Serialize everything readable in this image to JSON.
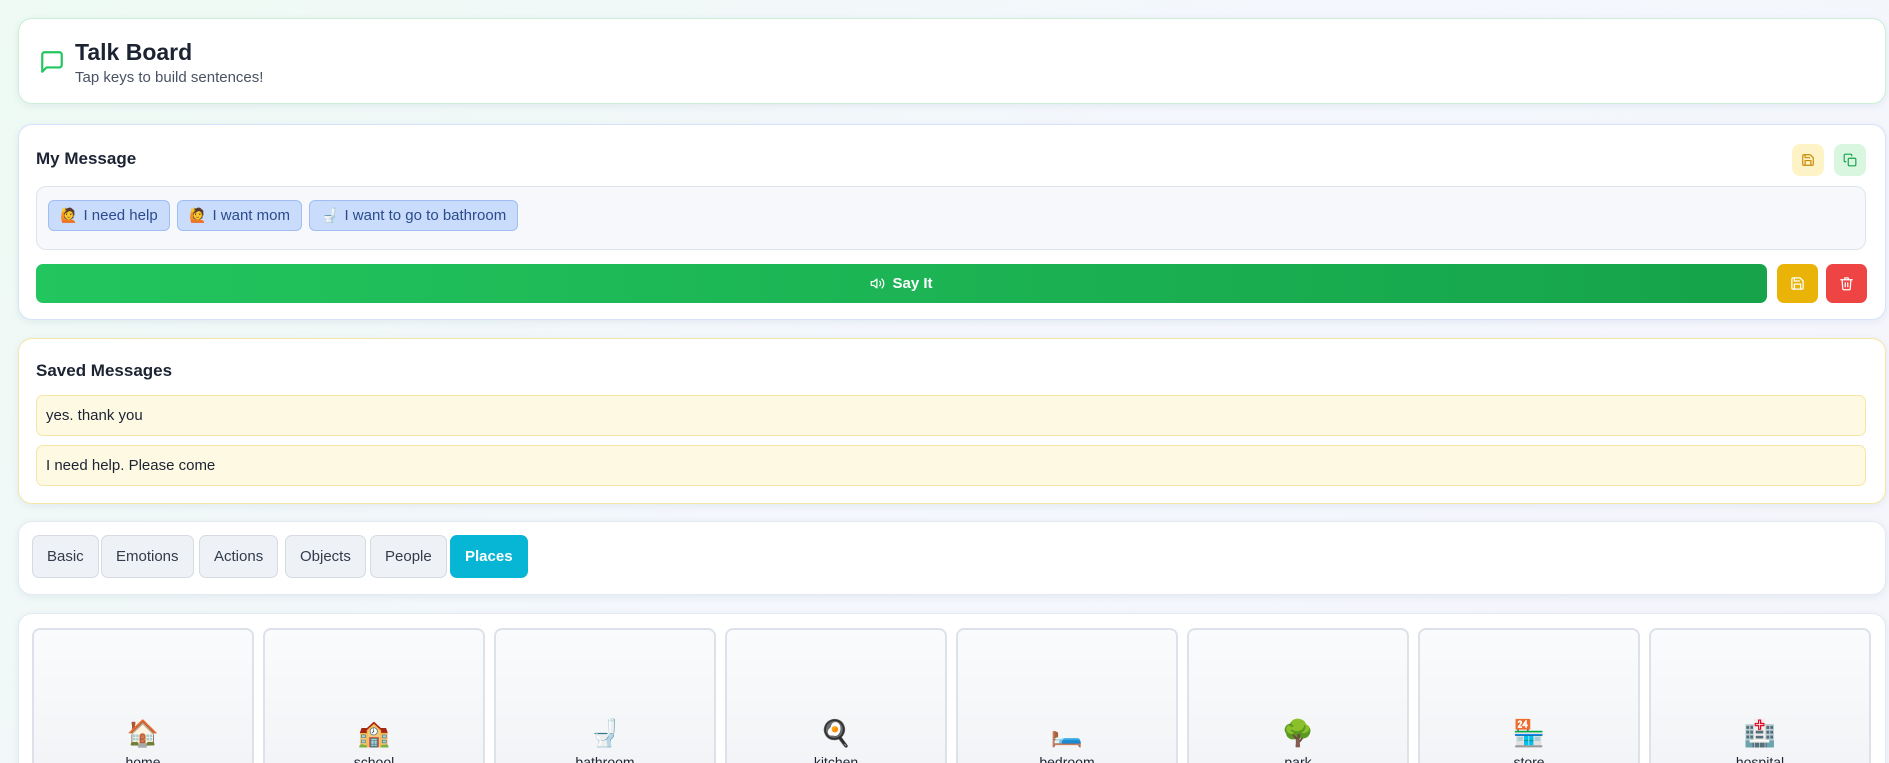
{
  "header": {
    "title": "Talk Board",
    "subtitle": "Tap keys to build sentences!",
    "icon": "message-square-icon"
  },
  "message": {
    "title": "My Message",
    "chips": [
      {
        "emoji": "🙋",
        "label": "I need help"
      },
      {
        "emoji": "🙋",
        "label": "I want mom"
      },
      {
        "emoji": "🚽",
        "label": "I want to go to bathroom"
      }
    ],
    "say_label": "Say It"
  },
  "saved": {
    "title": "Saved Messages",
    "items": [
      "yes. thank you",
      "I need help. Please come"
    ]
  },
  "tabs": {
    "items": [
      "Basic",
      "Emotions",
      "Actions",
      "Objects",
      "People",
      "Places"
    ],
    "active": "Places"
  },
  "keys": [
    {
      "emoji": "🏠",
      "label": "home"
    },
    {
      "emoji": "🏫",
      "label": "school"
    },
    {
      "emoji": "🚽",
      "label": "bathroom"
    },
    {
      "emoji": "🍳",
      "label": "kitchen"
    },
    {
      "emoji": "🛏️",
      "label": "bedroom"
    },
    {
      "emoji": "🌳",
      "label": "park"
    },
    {
      "emoji": "🏪",
      "label": "store"
    },
    {
      "emoji": "🏥",
      "label": "hospital"
    }
  ],
  "colors": {
    "accent_green": "#22c55e",
    "accent_cyan": "#06b6d4",
    "save_yellow": "#eab308",
    "delete_red": "#ef4444"
  }
}
